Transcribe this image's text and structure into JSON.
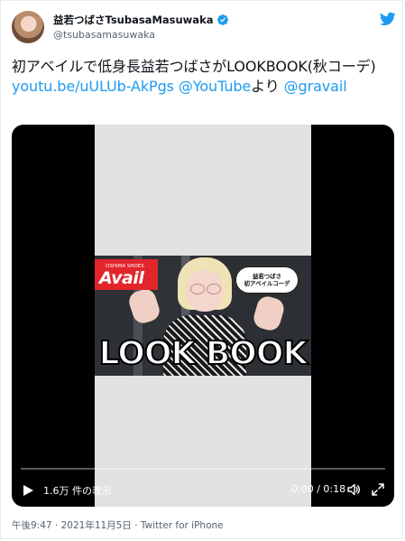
{
  "user": {
    "display_name": "益若つばさTsubasaMasuwaka",
    "handle": "@tsubasamasuwaka",
    "verified": true
  },
  "tweet": {
    "text_before": "初アベイルで低身長益若つばさがLOOKBOOK(秋コーデ) ",
    "link": "youtu.be/uULUb-AkPgs",
    "space": " ",
    "mention1": "@YouTube",
    "text_mid": "より ",
    "mention2": "@gravail"
  },
  "video": {
    "thumbnail": {
      "brand_small": "OSHIMA SHOES",
      "brand_logo": "Avail",
      "bubble_line1": "益若つばさ",
      "bubble_line2": "初アベイルコーデ",
      "headline": "LOOK BOOK"
    },
    "views": "1.6万 件の表示",
    "time": "0:00 / 0:18",
    "progress": 0
  },
  "meta": {
    "timestamp_line": "午後9:47 · 2021年11月5日 · Twitter for iPhone"
  },
  "colors": {
    "link": "#1d9bf0",
    "secondary_text": "#536471",
    "verified_badge": "#1d9bf0",
    "avail_red": "#e2242b"
  }
}
